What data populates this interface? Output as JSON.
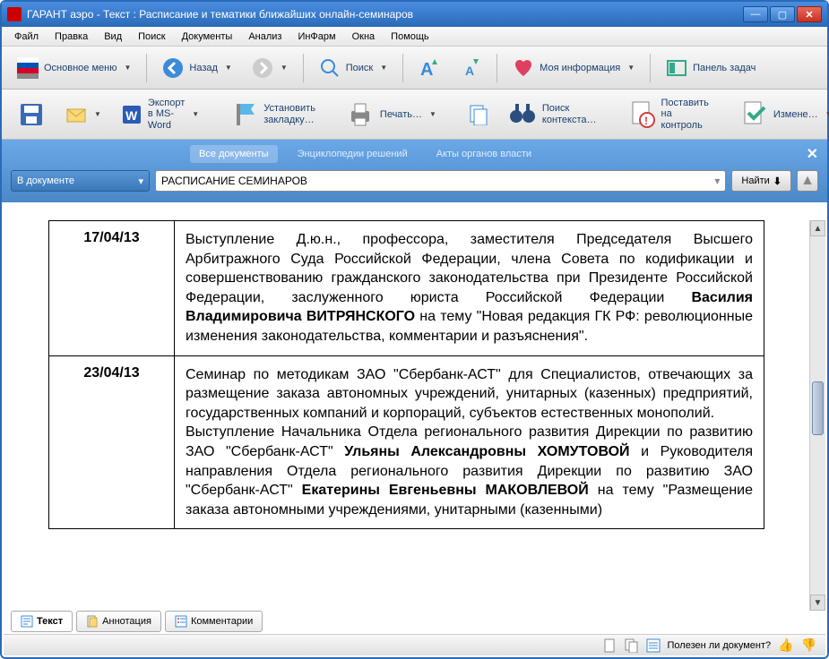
{
  "window": {
    "title": "ГАРАНТ аэро - Текст : Расписание и тематики ближайших онлайн-семинаров"
  },
  "menu": [
    "Файл",
    "Правка",
    "Вид",
    "Поиск",
    "Документы",
    "Анализ",
    "ИнФарм",
    "Окна",
    "Помощь"
  ],
  "toolbar1": {
    "main_menu": "Основное меню",
    "back": "Назад",
    "search": "Поиск",
    "my_info": "Моя информация",
    "task_panel": "Панель задач"
  },
  "toolbar2": {
    "export": "Экспорт в MS-Word",
    "bookmark": "Установить закладку…",
    "print": "Печать…",
    "context_search": "Поиск контекста…",
    "control": "Поставить на контроль",
    "changes": "Измене…"
  },
  "tabs": {
    "all_docs": "Все документы",
    "encyclopedia": "Энциклопедии решений",
    "acts": "Акты органов власти"
  },
  "search": {
    "scope": "В документе",
    "value": "РАСПИСАНИЕ СЕМИНАРОВ",
    "find": "Найти"
  },
  "schedule": [
    {
      "date": "17/04/13",
      "html": "Выступление Д.ю.н., профессора, заместителя Председателя Высшего Арбитражного Суда Российской Федерации, члена Совета по кодификации и совершенствованию гражданского законодательства при Президенте Российской Федерации, заслуженного юриста Российской Федерации <b>Василия Владимировича ВИТРЯНСКОГО</b> на тему \"Новая редакция ГК РФ: революционные изменения законодательства, комментарии и разъяснения\"."
    },
    {
      "date": "23/04/13",
      "html": "Семинар по методикам ЗАО \"Сбербанк-АСТ\" для Специалистов, отвечающих за размещение заказа автономных учреждений, унитарных (казенных) предприятий, государственных компаний и корпораций, субъектов естественных монополий.<br>Выступление Начальника Отдела регионального развития Дирекции по развитию ЗАО \"Сбербанк-АСТ\" <b>Ульяны Александровны ХОМУТОВОЙ</b> и Руководителя направления Отдела регионального развития Дирекции по развитию ЗАО \"Сбербанк-АСТ\" <b>Екатерины Евгеньевны МАКОВЛЕВОЙ</b> на тему \"Размещение заказа автономными учреждениями, унитарными (казенными)"
    }
  ],
  "bottom_tabs": {
    "text": "Текст",
    "annotation": "Аннотация",
    "comments": "Комментарии"
  },
  "status": {
    "useful": "Полезен ли документ?"
  }
}
